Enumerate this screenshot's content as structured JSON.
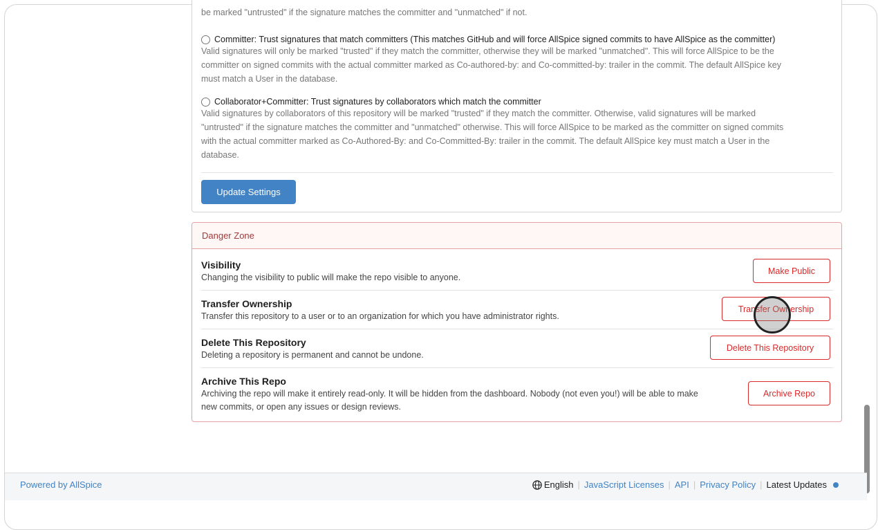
{
  "settings": {
    "top_fragment": "be marked \"untrusted\" if the signature matches the committer and \"unmatched\" if not.",
    "options": [
      {
        "title": "Committer: Trust signatures that match committers (This matches GitHub and will force AllSpice signed commits to have AllSpice as the committer)",
        "lines": [
          "Valid signatures will only be marked \"trusted\" if they match the committer, otherwise they will be marked \"unmatched\". This will force AllSpice to be the",
          "committer on signed commits with the actual committer marked as Co-authored-by: and Co-committed-by: trailer in the commit. The default AllSpice key",
          "must match a User in the database."
        ]
      },
      {
        "title": "Collaborator+Committer: Trust signatures by collaborators which match the committer",
        "lines": [
          "Valid signatures by collaborators of this repository will be marked \"trusted\" if they match the committer. Otherwise, valid signatures will be marked",
          "\"untrusted\" if the signature matches the committer and \"unmatched\" otherwise. This will force AllSpice to be marked as the committer on signed commits",
          "with the actual committer marked as Co-Authored-By: and Co-Committed-By: trailer in the commit. The default AllSpice key must match a User in the",
          "database."
        ]
      }
    ],
    "update_button": "Update Settings"
  },
  "danger_zone": {
    "header": "Danger Zone",
    "items": [
      {
        "title": "Visibility",
        "description": [
          "Changing the visibility to public will make the repo visible to anyone."
        ],
        "button": "Make Public"
      },
      {
        "title": "Transfer Ownership",
        "description": [
          "Transfer this repository to a user or to an organization for which you have administrator rights."
        ],
        "button": "Transfer Ownership"
      },
      {
        "title": "Delete This Repository",
        "description": [
          "Deleting a repository is permanent and cannot be undone."
        ],
        "button": "Delete This Repository"
      },
      {
        "title": "Archive This Repo",
        "description": [
          "Archiving the repo will make it entirely read-only. It will be hidden from the dashboard. Nobody (not even you!) will be able to make",
          "new commits, or open any issues or design reviews."
        ],
        "button": "Archive Repo"
      }
    ]
  },
  "footer": {
    "powered_by": "Powered by AllSpice",
    "language": "English",
    "links": [
      "JavaScript Licenses",
      "API",
      "Privacy Policy"
    ],
    "latest_updates": "Latest Updates"
  },
  "colors": {
    "primary": "#4183c4",
    "danger": "#db2828",
    "danger_header_bg": "#fff6f6"
  }
}
